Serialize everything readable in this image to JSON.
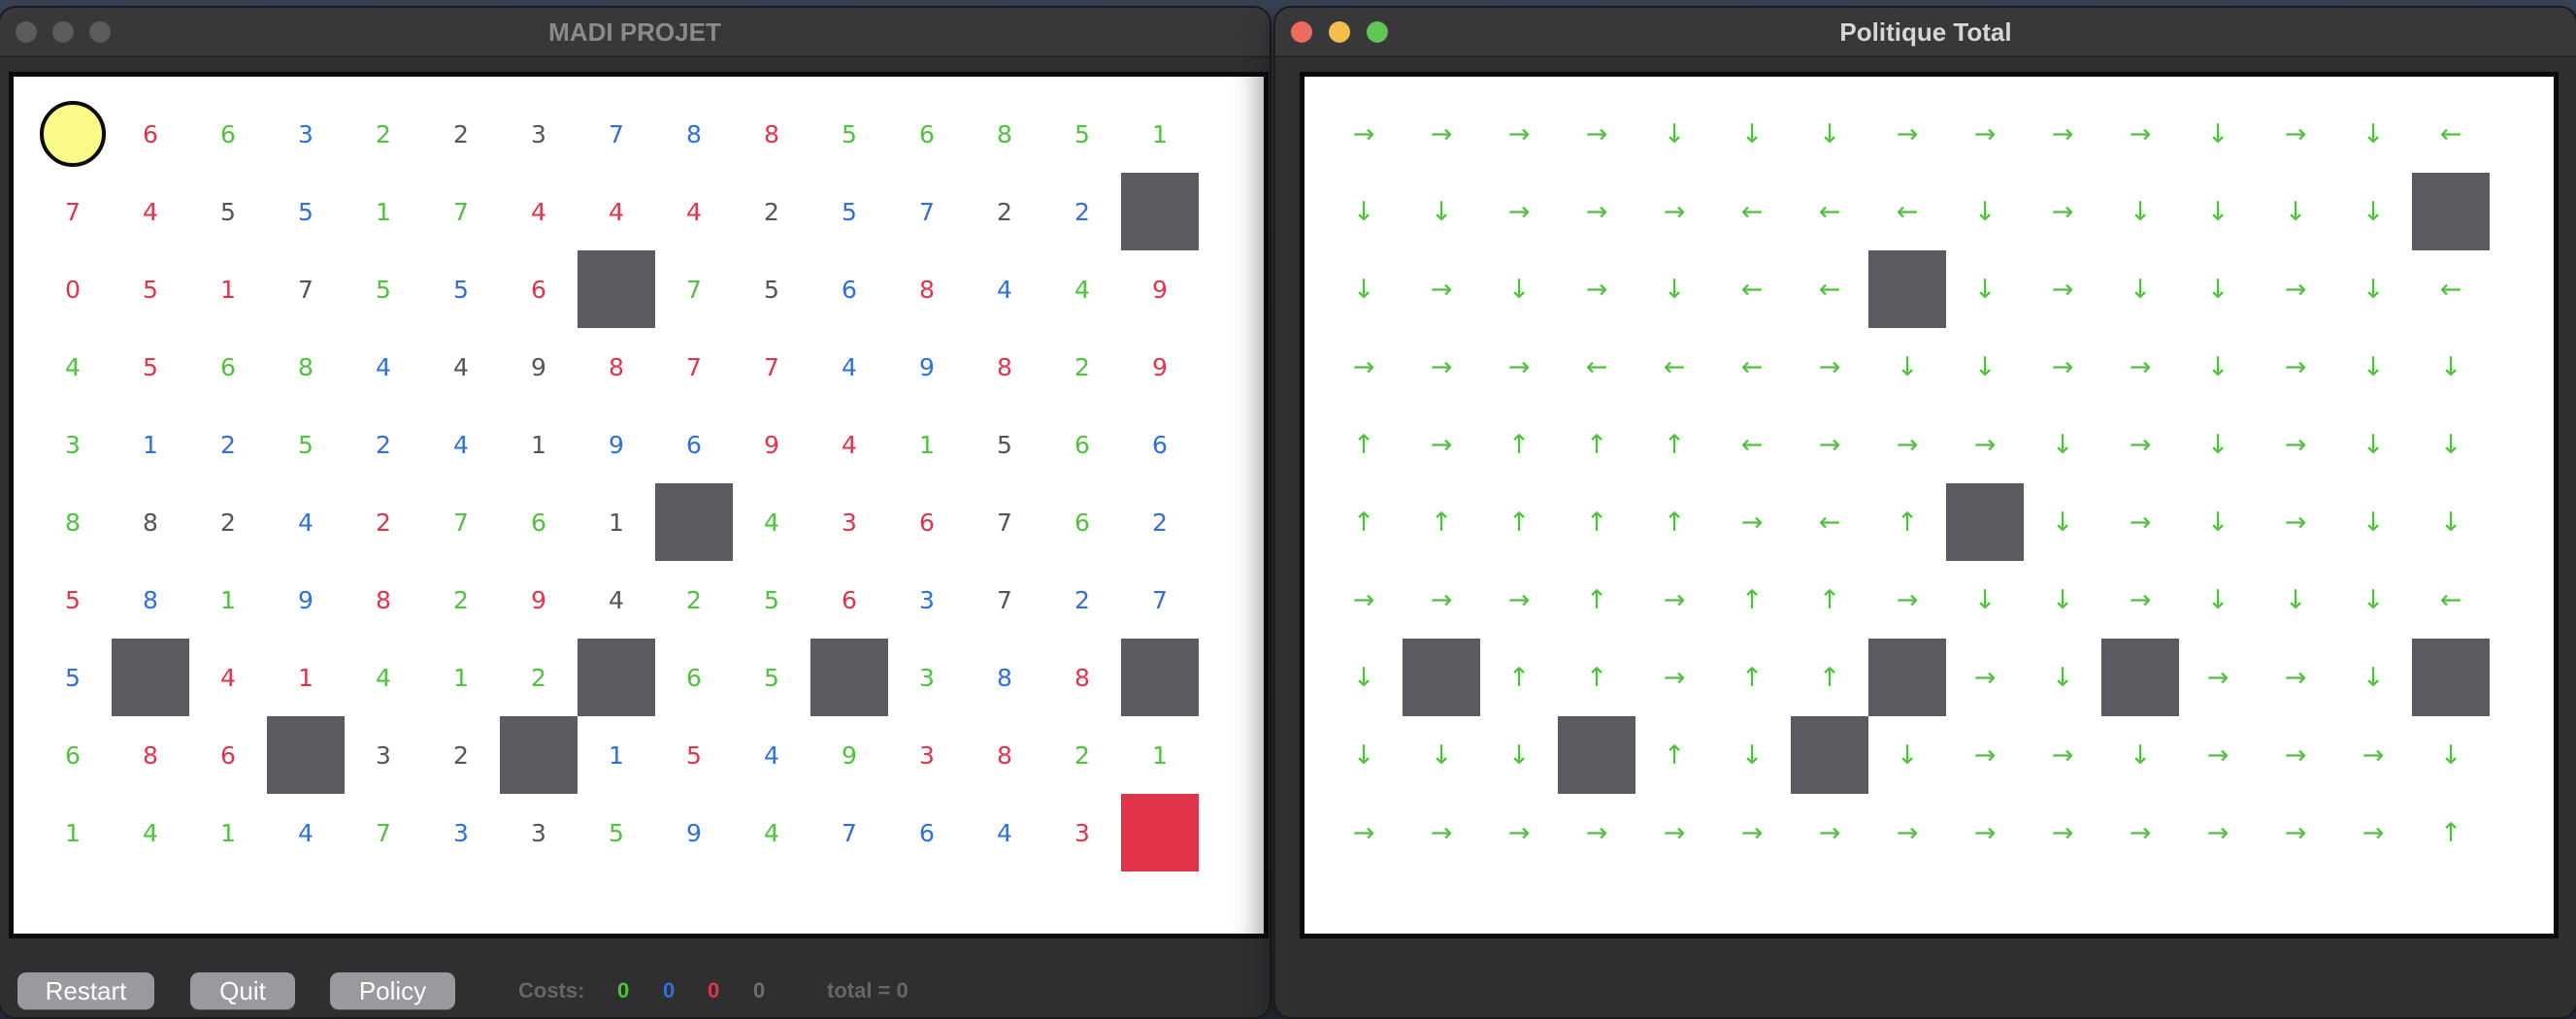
{
  "left_window": {
    "title": "MADI PROJET",
    "buttons": {
      "restart": "Restart",
      "quit": "Quit",
      "policy": "Policy"
    },
    "costs": {
      "label": "Costs:",
      "values": [
        {
          "value": "0",
          "color": "#4cc339"
        },
        {
          "value": "0",
          "color": "#2f6fe0"
        },
        {
          "value": "0",
          "color": "#e1344a"
        },
        {
          "value": "0",
          "color": "#6e6e70"
        }
      ],
      "total": "total = 0"
    },
    "grid": [
      [
        "@",
        "6r",
        "6g",
        "3b",
        "2g",
        "2k",
        "3k",
        "7b",
        "8b",
        "8r",
        "5g",
        "6g",
        "8g",
        "5g",
        "1g"
      ],
      [
        "7r",
        "4r",
        "5k",
        "5b",
        "1g",
        "7g",
        "4r",
        "4r",
        "4r",
        "2k",
        "5b",
        "7b",
        "2k",
        "2b",
        "#"
      ],
      [
        "0r",
        "5r",
        "1r",
        "7k",
        "5g",
        "5b",
        "6r",
        "#",
        "7g",
        "5k",
        "6b",
        "8r",
        "4b",
        "4g",
        "9r"
      ],
      [
        "4g",
        "5r",
        "6g",
        "8g",
        "4b",
        "4k",
        "9k",
        "8r",
        "7r",
        "7r",
        "4b",
        "9b",
        "8r",
        "2g",
        "9r"
      ],
      [
        "3g",
        "1b",
        "2b",
        "5g",
        "2b",
        "4b",
        "1k",
        "9b",
        "6b",
        "9r",
        "4r",
        "1g",
        "5k",
        "6g",
        "6b"
      ],
      [
        "8g",
        "8k",
        "2k",
        "4b",
        "2r",
        "7g",
        "6g",
        "1k",
        "#",
        "4g",
        "3r",
        "6r",
        "7k",
        "6g",
        "2b"
      ],
      [
        "5r",
        "8b",
        "1g",
        "9b",
        "8r",
        "2g",
        "9r",
        "4k",
        "2g",
        "5g",
        "6r",
        "3b",
        "7k",
        "2b",
        "7b"
      ],
      [
        "5b",
        "#",
        "4r",
        "1r",
        "4g",
        "1g",
        "2g",
        "#",
        "6g",
        "5g",
        "#",
        "3g",
        "8b",
        "8r",
        "#"
      ],
      [
        "6g",
        "8r",
        "6r",
        "#",
        "3k",
        "2k",
        "#",
        "1b",
        "5r",
        "4b",
        "9g",
        "3r",
        "8r",
        "2g",
        "1g"
      ],
      [
        "1g",
        "4g",
        "1g",
        "4b",
        "7g",
        "3b",
        "3k",
        "5g",
        "9b",
        "4g",
        "7b",
        "6b",
        "4b",
        "3r",
        "$"
      ]
    ]
  },
  "right_window": {
    "title": "Politique Total",
    "policy": [
      [
        "→",
        "→",
        "→",
        "→",
        "↓",
        "↓",
        "↓",
        "→",
        "→",
        "→",
        "→",
        "↓",
        "→",
        "↓",
        "←"
      ],
      [
        "↓",
        "↓",
        "→",
        "→",
        "→",
        "←",
        "←",
        "←",
        "↓",
        "→",
        "↓",
        "↓",
        "↓",
        "↓",
        "#"
      ],
      [
        "↓",
        "→",
        "↓",
        "→",
        "↓",
        "←",
        "←",
        "#",
        "↓",
        "→",
        "↓",
        "↓",
        "→",
        "↓",
        "←"
      ],
      [
        "→",
        "→",
        "→",
        "←",
        "←",
        "←",
        "→",
        "↓",
        "↓",
        "→",
        "→",
        "↓",
        "→",
        "↓",
        "↓"
      ],
      [
        "↑",
        "→",
        "↑",
        "↑",
        "↑",
        "←",
        "→",
        "→",
        "→",
        "↓",
        "→",
        "↓",
        "→",
        "↓",
        "↓"
      ],
      [
        "↑",
        "↑",
        "↑",
        "↑",
        "↑",
        "→",
        "←",
        "↑",
        "#",
        "↓",
        "→",
        "↓",
        "→",
        "↓",
        "↓"
      ],
      [
        "→",
        "→",
        "→",
        "↑",
        "→",
        "↑",
        "↑",
        "→",
        "↓",
        "↓",
        "→",
        "↓",
        "↓",
        "↓",
        "←"
      ],
      [
        "↓",
        "#",
        "↑",
        "↑",
        "→",
        "↑",
        "↑",
        "#",
        "→",
        "↓",
        "#",
        "→",
        "→",
        "↓",
        "#"
      ],
      [
        "↓",
        "↓",
        "↓",
        "#",
        "↑",
        "↓",
        "#",
        "↓",
        "→",
        "→",
        "↓",
        "→",
        "→",
        "→",
        "↓"
      ],
      [
        "→",
        "→",
        "→",
        "→",
        "→",
        "→",
        "→",
        "→",
        "→",
        "→",
        "→",
        "→",
        "→",
        "→",
        "↑"
      ]
    ]
  },
  "colors": {
    "green": "#4cc339",
    "blue": "#2f6fe0",
    "red": "#e1344a",
    "gray": "#555557",
    "wall": "#5b5a60",
    "goal": "#e1344a",
    "agent": "#fafa8a",
    "arrow": "#4cc339",
    "title_dim": "#8a8a8c",
    "title_active": "#d6d6d8"
  }
}
